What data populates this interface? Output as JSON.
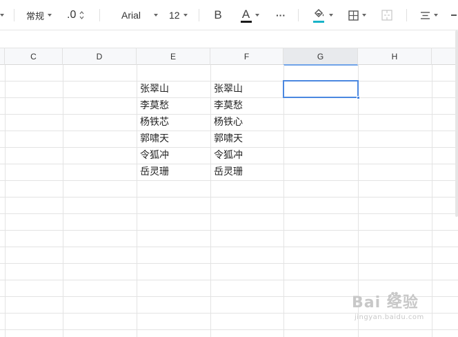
{
  "toolbar": {
    "number_format": "常规",
    "decimal_button": ".0",
    "font_name": "Arial",
    "font_size": "12",
    "bold_label": "B",
    "font_color_label": "A",
    "more_label": "···",
    "font_color_underline": "#1a1a1a",
    "fill_color_underline": "#19b3c8"
  },
  "columns": [
    "C",
    "D",
    "E",
    "F",
    "G",
    "H"
  ],
  "selected_column": "G",
  "cells": {
    "E": [
      "张翠山",
      "李莫愁",
      "杨铁芯",
      "郭啸天",
      "令狐冲",
      "岳灵珊"
    ],
    "F": [
      "张翠山",
      "李莫愁",
      "杨铁心",
      "郭啸天",
      "令狐冲",
      "岳灵珊"
    ]
  },
  "watermark": {
    "brand": "Bai 经验",
    "url": "jingyan.baidu.com"
  }
}
